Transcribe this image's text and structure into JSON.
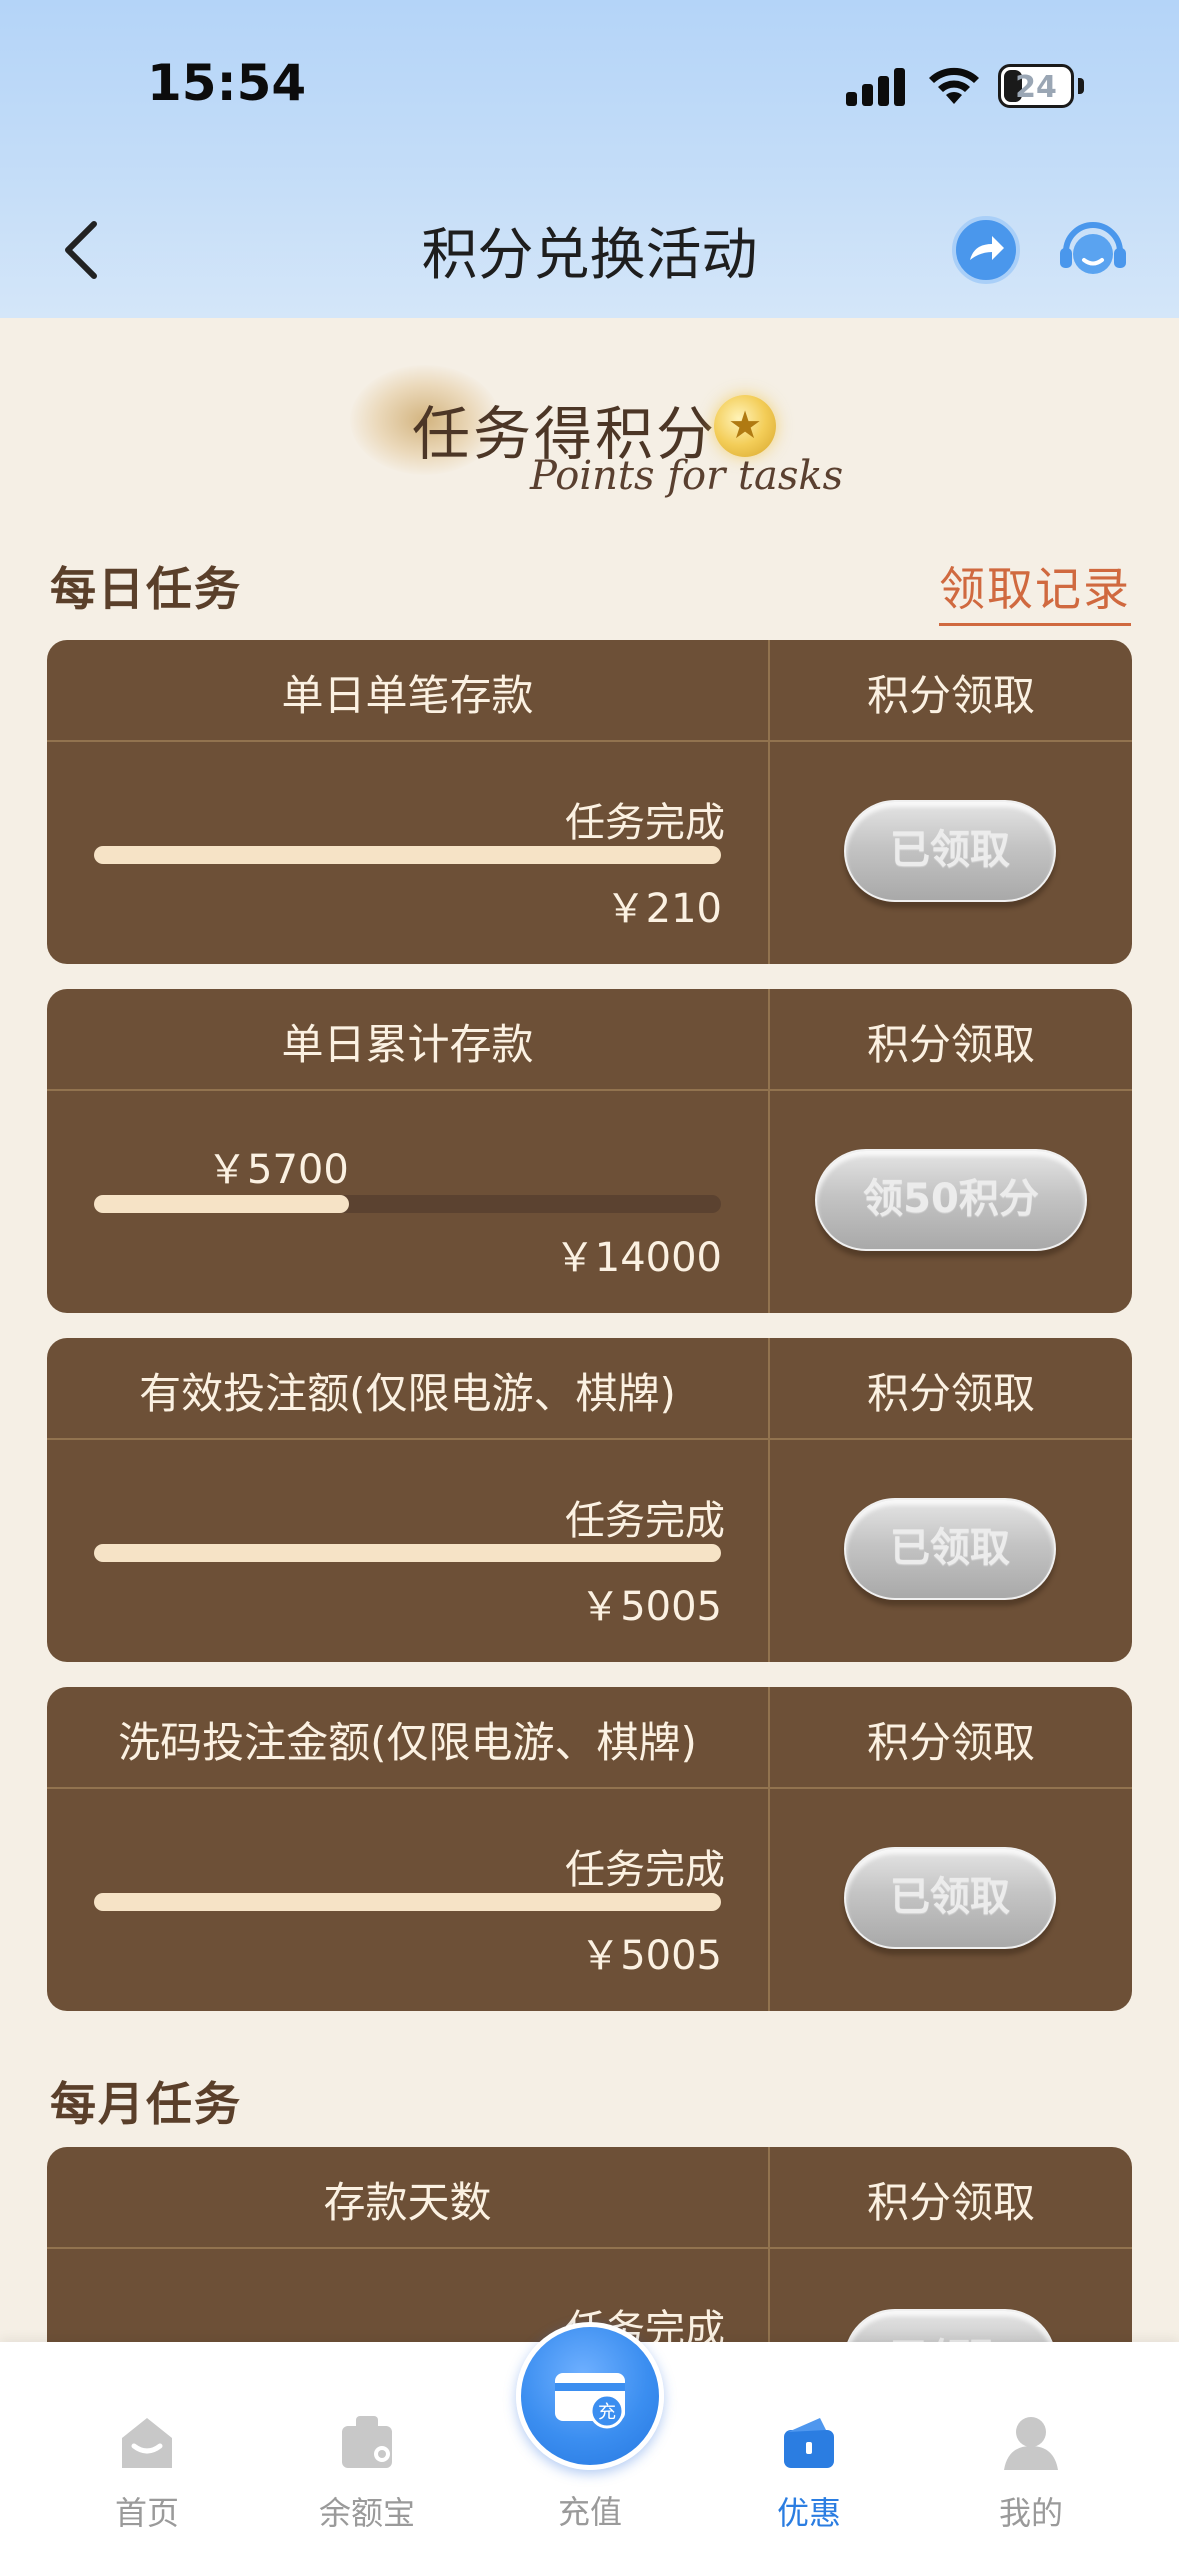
{
  "status_bar": {
    "time": "15:54",
    "battery": "24"
  },
  "nav": {
    "title": "积分兑换活动"
  },
  "banner": {
    "title": "任务得积分",
    "subtitle": "Points for tasks"
  },
  "daily": {
    "title": "每日任务",
    "record_link": "领取记录",
    "tasks": [
      {
        "title": "单日单笔存款",
        "action_header": "积分领取",
        "progress_label": "任务完成",
        "current": "",
        "target": "￥210",
        "progress": 1.0,
        "button": "已领取"
      },
      {
        "title": "单日累计存款",
        "action_header": "积分领取",
        "progress_label": "",
        "current": "￥5700",
        "target": "￥14000",
        "progress": 0.407,
        "button": "领50积分"
      },
      {
        "title": "有效投注额(仅限电游、棋牌)",
        "action_header": "积分领取",
        "progress_label": "任务完成",
        "current": "",
        "target": "￥5005",
        "progress": 1.0,
        "button": "已领取"
      },
      {
        "title": "洗码投注金额(仅限电游、棋牌)",
        "action_header": "积分领取",
        "progress_label": "任务完成",
        "current": "",
        "target": "￥5005",
        "progress": 1.0,
        "button": "已领取"
      }
    ]
  },
  "monthly": {
    "title": "每月任务",
    "tasks": [
      {
        "title": "存款天数",
        "action_header": "积分领取",
        "progress_label": "任务完成",
        "button": "已领取"
      }
    ]
  },
  "tabbar": {
    "items": [
      {
        "label": "首页",
        "icon": "home-icon"
      },
      {
        "label": "余额宝",
        "icon": "wallet-icon"
      },
      {
        "label": "充值",
        "icon": "recharge-icon"
      },
      {
        "label": "优惠",
        "icon": "promo-icon",
        "active": true
      },
      {
        "label": "我的",
        "icon": "profile-icon"
      }
    ],
    "active_color": "#2b7de1"
  },
  "colors": {
    "card": "#6d5037",
    "page_bg": "#f5efe5",
    "link": "#d0693f",
    "header": "#b4d4f8"
  }
}
